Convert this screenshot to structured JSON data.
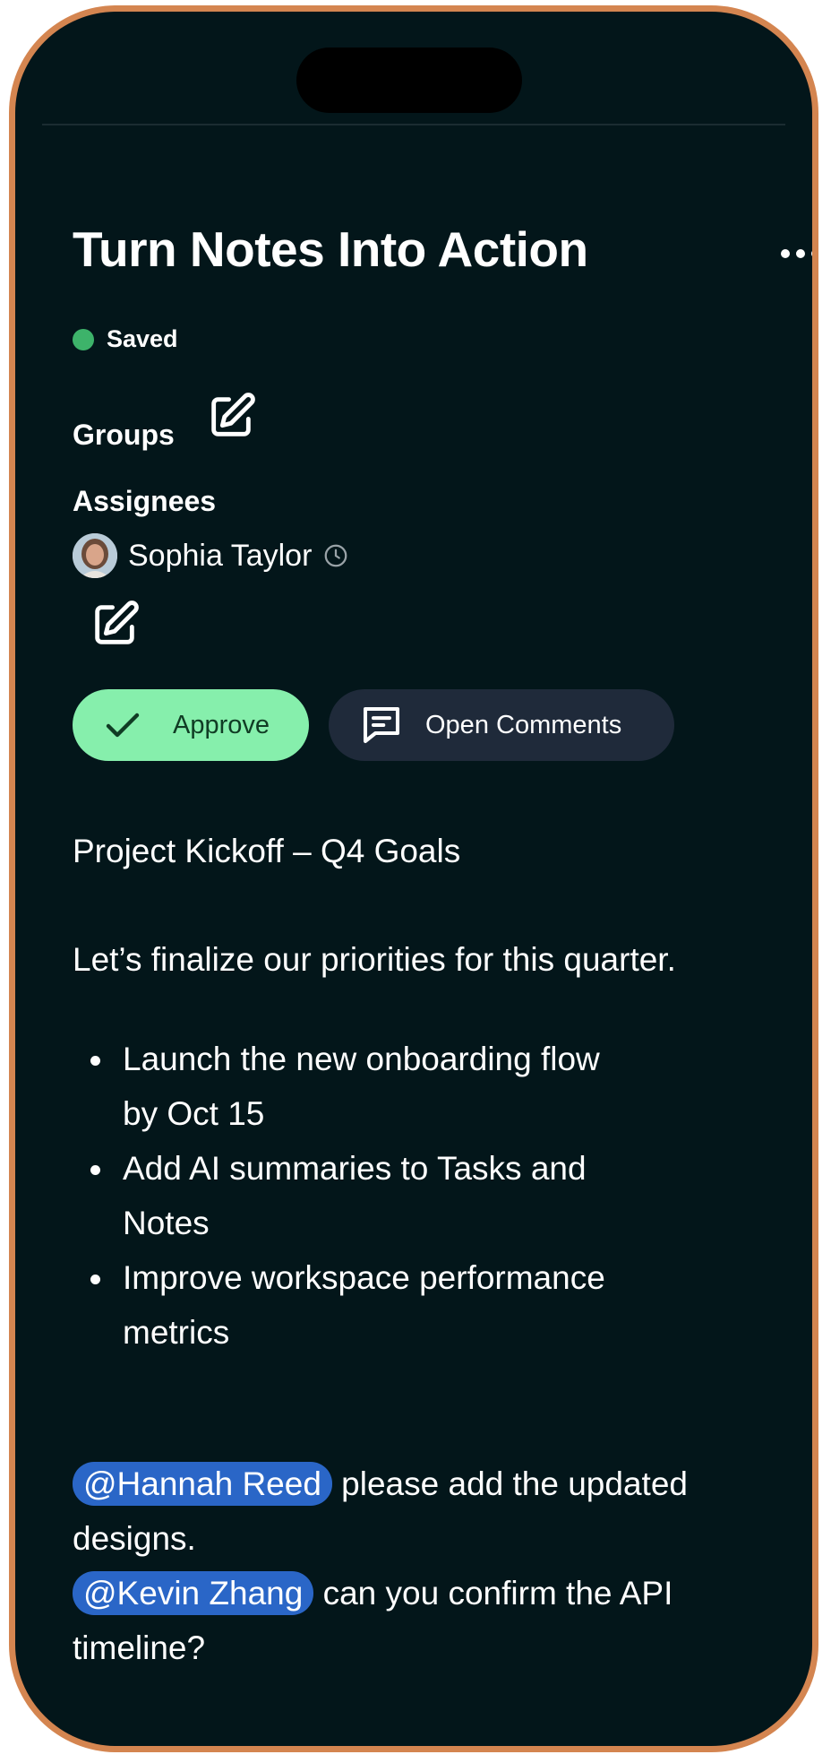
{
  "note": {
    "title": "Turn Notes Into Action",
    "status": "Saved",
    "colors": {
      "status_dot": "#3db36a",
      "approve_bg": "#86efac",
      "mention_bg": "#2a66c7",
      "background": "#03161a"
    },
    "groups_label": "Groups",
    "assignees_label": "Assignees",
    "assignee": {
      "name": "Sophia Taylor"
    }
  },
  "actions": {
    "approve_label": "Approve",
    "comments_label": "Open Comments"
  },
  "body": {
    "heading": "Project Kickoff – Q4 Goals",
    "intro": "Let’s finalize our priorities for this quarter.",
    "bullets": [
      {
        "line1": "Launch the new onboarding flow",
        "line2": "by Oct 15"
      },
      {
        "line1": "Add AI summaries to Tasks and",
        "line2": "Notes"
      },
      {
        "line1": "Improve workspace performance",
        "line2": "metrics"
      }
    ],
    "mentions": [
      {
        "name": "@Hannah Reed",
        "text": " please add the updated designs."
      },
      {
        "name": "@Kevin Zhang",
        "text": " can you confirm the API timeline?"
      }
    ]
  },
  "icons": {
    "more": "more-horizontal-icon",
    "edit": "pencil-square-icon",
    "clock": "clock-icon",
    "check": "check-icon",
    "comment": "comment-icon"
  }
}
